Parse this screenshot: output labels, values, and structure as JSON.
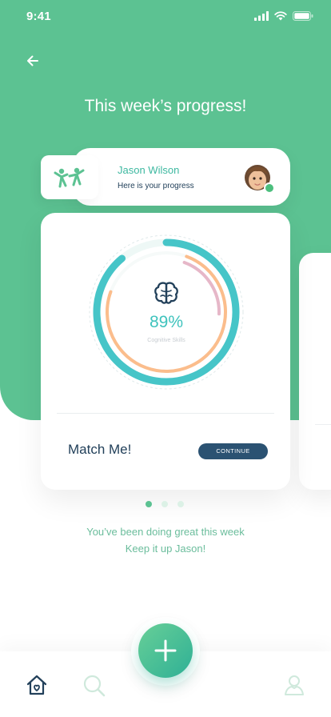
{
  "status_bar": {
    "time": "9:41"
  },
  "header": {
    "title": "This week’s progress!"
  },
  "profile": {
    "name": "Jason Wilson",
    "subtitle": "Here is your progress",
    "online": true
  },
  "progress_card": {
    "percent_label": "89%",
    "skill_label": "Cognitive Skills",
    "game_name": "Match Me!",
    "continue_label": "CONTINUE",
    "rings": [
      {
        "name": "outer",
        "fraction": 0.89,
        "color": "#46c5c8"
      },
      {
        "name": "middle",
        "fraction": 0.75,
        "color": "#fbbd8c"
      },
      {
        "name": "inner",
        "fraction": 0.2,
        "color": "#e6b7c8"
      }
    ]
  },
  "pagination": {
    "count": 3,
    "active": 0
  },
  "message": {
    "line1": "You’ve been doing great this week",
    "line2": "Keep it up Jason!"
  },
  "tab_bar": {
    "items": [
      "home-icon",
      "search-icon",
      "add-icon",
      "profile-icon"
    ],
    "active": "home-icon"
  },
  "colors": {
    "brand": "#5cc292",
    "accent": "#46c5c8",
    "dark": "#22405a"
  }
}
